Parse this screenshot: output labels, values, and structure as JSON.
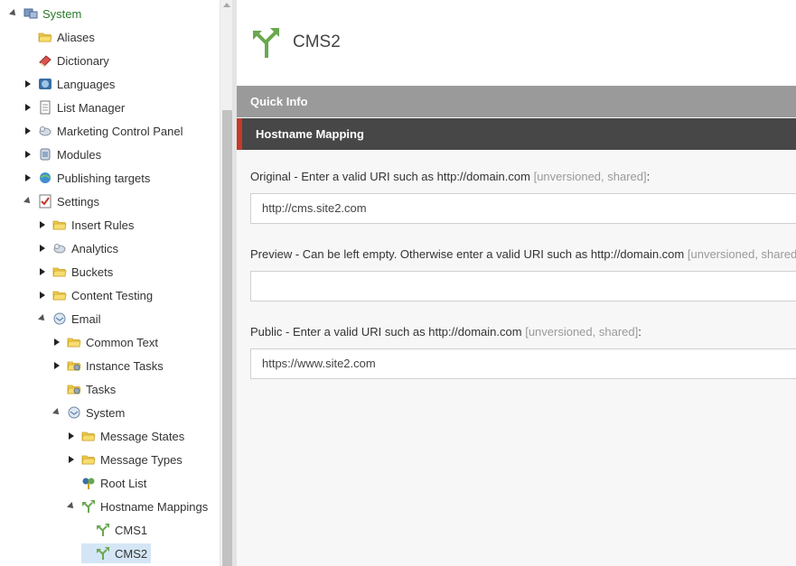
{
  "tree": {
    "items": [
      {
        "label": "System",
        "icon": "system-icon",
        "expander": "down",
        "depth": 0
      },
      {
        "label": "Aliases",
        "icon": "folder-icon",
        "expander": "none",
        "depth": 1
      },
      {
        "label": "Dictionary",
        "icon": "dictionary-icon",
        "expander": "none",
        "depth": 1
      },
      {
        "label": "Languages",
        "icon": "languages-icon",
        "expander": "right",
        "depth": 1
      },
      {
        "label": "List Manager",
        "icon": "list-manager-icon",
        "expander": "right",
        "depth": 1
      },
      {
        "label": "Marketing Control Panel",
        "icon": "marketing-icon",
        "expander": "right",
        "depth": 1
      },
      {
        "label": "Modules",
        "icon": "modules-icon",
        "expander": "right",
        "depth": 1
      },
      {
        "label": "Publishing targets",
        "icon": "publishing-icon",
        "expander": "right",
        "depth": 1
      },
      {
        "label": "Settings",
        "icon": "settings-icon",
        "expander": "down",
        "depth": 1
      },
      {
        "label": "Insert Rules",
        "icon": "folder-icon",
        "expander": "right",
        "depth": 2
      },
      {
        "label": "Analytics",
        "icon": "analytics-icon",
        "expander": "right",
        "depth": 2
      },
      {
        "label": "Buckets",
        "icon": "folder-icon",
        "expander": "right",
        "depth": 2
      },
      {
        "label": "Content Testing",
        "icon": "folder-icon",
        "expander": "right",
        "depth": 2
      },
      {
        "label": "Email",
        "icon": "email-icon",
        "expander": "down",
        "depth": 2
      },
      {
        "label": "Common Text",
        "icon": "folder-icon",
        "expander": "right",
        "depth": 3
      },
      {
        "label": "Instance Tasks",
        "icon": "tasks-folder-icon",
        "expander": "right",
        "depth": 3
      },
      {
        "label": "Tasks",
        "icon": "tasks-folder-icon",
        "expander": "none",
        "depth": 3
      },
      {
        "label": "System",
        "icon": "email-system-icon",
        "expander": "down",
        "depth": 3
      },
      {
        "label": "Message States",
        "icon": "folder-icon",
        "expander": "right",
        "depth": 4
      },
      {
        "label": "Message Types",
        "icon": "folder-icon",
        "expander": "right",
        "depth": 4
      },
      {
        "label": "Root List",
        "icon": "root-list-icon",
        "expander": "none",
        "depth": 4
      },
      {
        "label": "Hostname Mappings",
        "icon": "hostname-mapping-icon",
        "expander": "down",
        "depth": 4
      },
      {
        "label": "CMS1",
        "icon": "hostname-mapping-icon",
        "expander": "none",
        "depth": 5
      },
      {
        "label": "CMS2",
        "icon": "hostname-mapping-icon",
        "expander": "none",
        "depth": 5,
        "selected": true
      }
    ]
  },
  "header": {
    "title": "CMS2",
    "icon": "hostname-mapping-icon"
  },
  "quick_info": {
    "label": "Quick Info"
  },
  "section": {
    "label": "Hostname Mapping",
    "accent": "#c53a2a"
  },
  "fields": [
    {
      "label": "Original - Enter a valid URI such as http://domain.com",
      "meta": "[unversioned, shared]",
      "suffix": ":",
      "value": "http://cms.site2.com"
    },
    {
      "label": "Preview - Can be left empty. Otherwise enter a valid URI such as http://domain.com",
      "meta": "[unversioned, shared]",
      "suffix": ":",
      "value": ""
    },
    {
      "label": "Public - Enter a valid URI such as http://domain.com",
      "meta": "[unversioned, shared]",
      "suffix": ":",
      "value": "https://www.site2.com"
    }
  ]
}
